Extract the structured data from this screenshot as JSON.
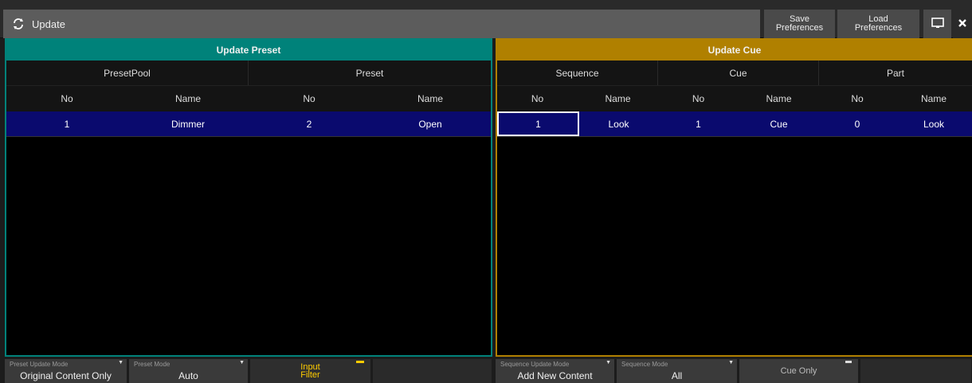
{
  "window": {
    "title": "Update",
    "icon": "refresh-icon"
  },
  "toolbar": {
    "save_line1": "Save",
    "save_line2": "Preferences",
    "load_line1": "Load",
    "load_line2": "Preferences",
    "screen_icon": "monitor-icon",
    "close_icon": "close-icon"
  },
  "update_preset": {
    "header": "Update Preset",
    "groups": [
      "PresetPool",
      "Preset"
    ],
    "columns": [
      "No",
      "Name",
      "No",
      "Name"
    ],
    "rows": [
      {
        "pool_no": "1",
        "pool_name": "Dimmer",
        "preset_no": "2",
        "preset_name": "Open"
      }
    ],
    "color": "#00827a"
  },
  "update_cue": {
    "header": "Update Cue",
    "groups": [
      "Sequence",
      "Cue",
      "Part"
    ],
    "columns": [
      "No",
      "Name",
      "No",
      "Name",
      "No",
      "Name"
    ],
    "rows": [
      {
        "seq_no": "1",
        "seq_name": "Look",
        "cue_no": "1",
        "cue_name": "Cue",
        "part_no": "0",
        "part_name": "Look"
      }
    ],
    "color": "#b08000",
    "row_color": "#0a0a6e"
  },
  "bottom": {
    "preset_update_mode_label": "Preset Update Mode",
    "preset_update_mode_value": "Original Content Only",
    "preset_mode_label": "Preset Mode",
    "preset_mode_value": "Auto",
    "input_filter_line1": "Input",
    "input_filter_line2": "Filter",
    "sequence_update_mode_label": "Sequence Update Mode",
    "sequence_update_mode_value": "Add New Content",
    "sequence_mode_label": "Sequence Mode",
    "sequence_mode_value": "All",
    "cue_only_label": "Cue Only"
  }
}
